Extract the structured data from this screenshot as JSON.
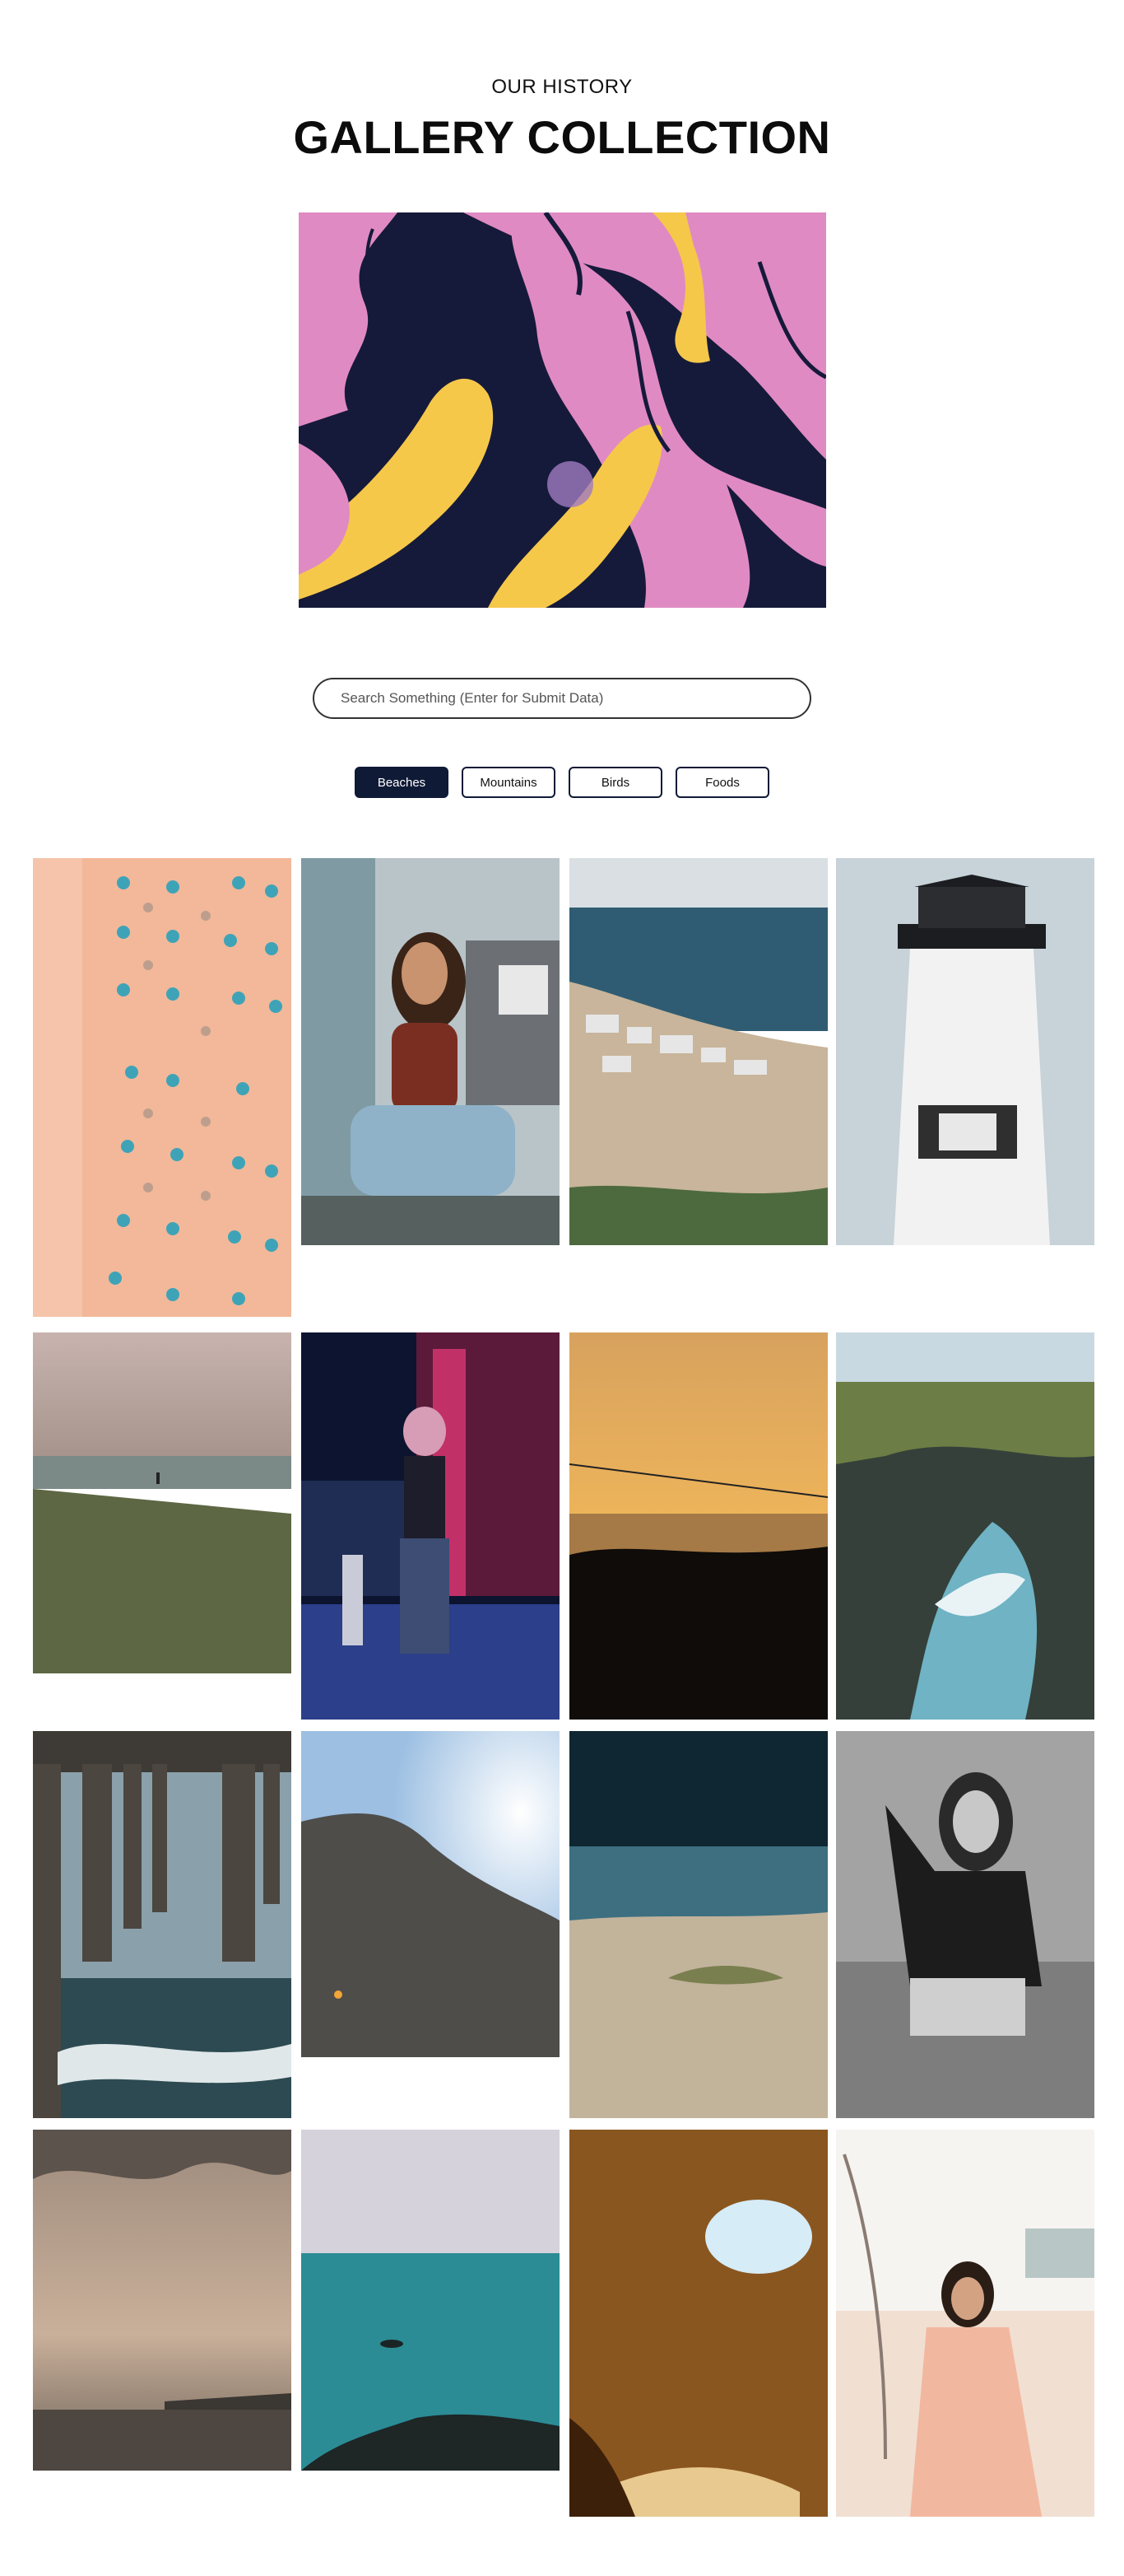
{
  "header": {
    "eyebrow": "OUR HISTORY",
    "title": "GALLERY COLLECTION"
  },
  "search": {
    "placeholder": "Search Something (Enter for Submit Data)"
  },
  "filters": [
    {
      "label": "Beaches",
      "active": true
    },
    {
      "label": "Mountains",
      "active": false
    },
    {
      "label": "Birds",
      "active": false
    },
    {
      "label": "Foods",
      "active": false
    }
  ],
  "colors": {
    "accent": "#0f1a36",
    "hero_pink": "#e08ac3",
    "hero_navy": "#161a3a",
    "hero_yellow": "#f5c84a"
  }
}
